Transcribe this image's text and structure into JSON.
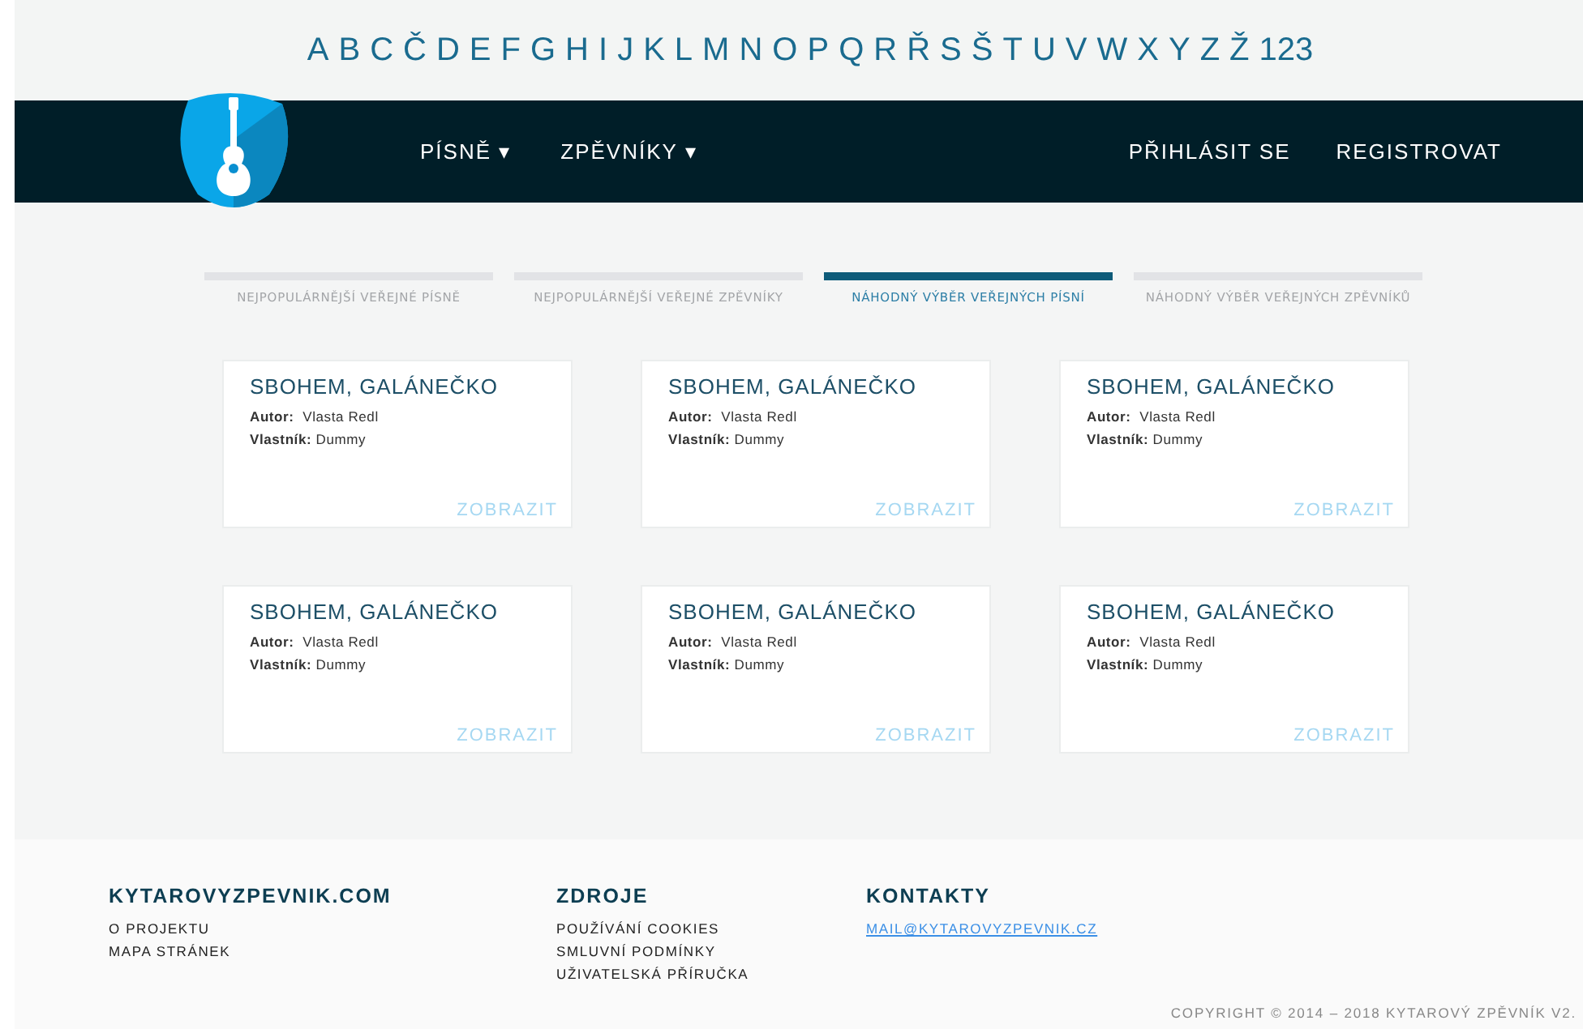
{
  "alphabet": [
    "A",
    "B",
    "C",
    "Č",
    "D",
    "E",
    "F",
    "G",
    "H",
    "I",
    "J",
    "K",
    "L",
    "M",
    "N",
    "O",
    "P",
    "Q",
    "R",
    "Ř",
    "S",
    "Š",
    "T",
    "U",
    "V",
    "W",
    "X",
    "Y",
    "Z",
    "Ž",
    "123"
  ],
  "nav": {
    "menus": [
      {
        "label": "PÍSNĚ",
        "caret": "▾"
      },
      {
        "label": "ZPĚVNÍKY",
        "caret": "▾"
      }
    ],
    "actions": [
      "PŘIHLÁSIT SE",
      "REGISTROVAT"
    ]
  },
  "tabs": [
    {
      "label": "NEJPOPULÁRNĚJŠÍ VEŘEJNÉ PÍSNĚ",
      "selected": false
    },
    {
      "label": "NEJPOPULÁRNĚJŠÍ VEŘEJNÉ ZPĚVNÍKY",
      "selected": false
    },
    {
      "label": "NÁHODNÝ VÝBĚR VEŘEJNÝCH PÍSNÍ",
      "selected": true
    },
    {
      "label": "NÁHODNÝ VÝBĚR VEŘEJNÝCH ZPĚVNÍKŮ",
      "selected": false
    }
  ],
  "cards": [
    {
      "title": "SBOHEM, GALÁNEČKO",
      "author_label": "Autor:",
      "author": "Vlasta Redl",
      "owner_label": "Vlastník:",
      "owner": "Dummy",
      "link": "ZOBRAZIT"
    },
    {
      "title": "SBOHEM, GALÁNEČKO",
      "author_label": "Autor:",
      "author": "Vlasta Redl",
      "owner_label": "Vlastník:",
      "owner": "Dummy",
      "link": "ZOBRAZIT"
    },
    {
      "title": "SBOHEM, GALÁNEČKO",
      "author_label": "Autor:",
      "author": "Vlasta Redl",
      "owner_label": "Vlastník:",
      "owner": "Dummy",
      "link": "ZOBRAZIT"
    },
    {
      "title": "SBOHEM, GALÁNEČKO",
      "author_label": "Autor:",
      "author": "Vlasta Redl",
      "owner_label": "Vlastník:",
      "owner": "Dummy",
      "link": "ZOBRAZIT"
    },
    {
      "title": "SBOHEM, GALÁNEČKO",
      "author_label": "Autor:",
      "author": "Vlasta Redl",
      "owner_label": "Vlastník:",
      "owner": "Dummy",
      "link": "ZOBRAZIT"
    },
    {
      "title": "SBOHEM, GALÁNEČKO",
      "author_label": "Autor:",
      "author": "Vlasta Redl",
      "owner_label": "Vlastník:",
      "owner": "Dummy",
      "link": "ZOBRAZIT"
    }
  ],
  "footer": {
    "columns": [
      {
        "heading": "KYTAROVYZPEVNIK.COM",
        "links": [
          {
            "label": "O PROJEKTU",
            "kind": "plain"
          },
          {
            "label": "MAPA STRÁNEK",
            "kind": "plain"
          }
        ]
      },
      {
        "heading": "ZDROJE",
        "links": [
          {
            "label": "POUŽÍVÁNÍ COOKIES",
            "kind": "plain"
          },
          {
            "label": "SMLUVNÍ PODMÍNKY",
            "kind": "plain"
          },
          {
            "label": "UŽIVATELSKÁ PŘÍRUČKA",
            "kind": "plain"
          }
        ]
      },
      {
        "heading": "KONTAKTY",
        "links": [
          {
            "label": "MAIL@KYTAROVYZPEVNIK.CZ",
            "kind": "email"
          }
        ]
      }
    ],
    "copyright": "COPYRIGHT © 2014 – 2018 KYTAROVÝ ZPĚVNÍK V2."
  }
}
